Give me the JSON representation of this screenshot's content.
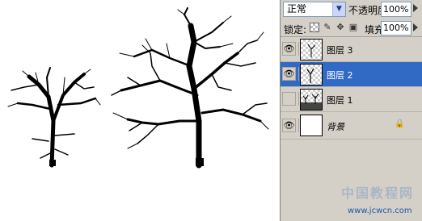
{
  "canvas": {
    "background": "#ffffff",
    "tree_color": "#000000"
  },
  "layers_panel": {
    "blend_mode": "正常",
    "opacity_label": "不透明度:",
    "opacity_value": "100%",
    "lock_label": "锁定:",
    "lock_icons": [
      "lock-transparent-icon",
      "brush-icon",
      "move-icon",
      "padlock-icon"
    ],
    "fill_label": "填充:",
    "fill_value": "100%",
    "layers": [
      {
        "name": "图层 3",
        "visible": true,
        "selected": false,
        "linked": false
      },
      {
        "name": "图层 2",
        "visible": true,
        "selected": true,
        "linked": true
      },
      {
        "name": "图层 1",
        "visible": false,
        "selected": false,
        "linked": false
      },
      {
        "name": "背景",
        "visible": true,
        "selected": false,
        "locked": true
      }
    ],
    "selected_color": "#316ac5",
    "panel_color": "#d4d0c8"
  },
  "watermark": {
    "title": "中国教程网",
    "url": "www.jcwcn.com"
  }
}
